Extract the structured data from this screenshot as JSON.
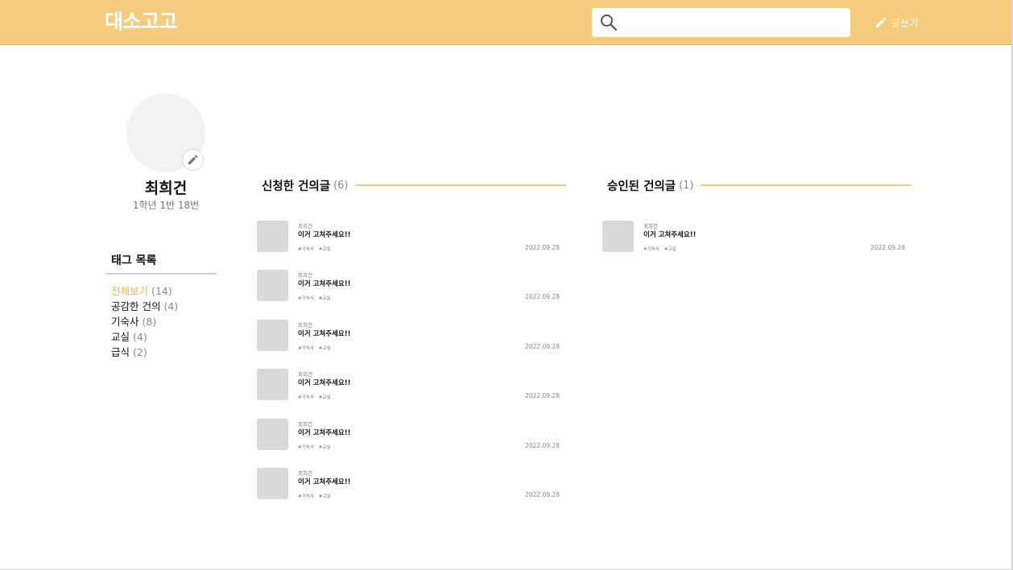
{
  "header": {
    "logo": "대소고고",
    "search_placeholder": "",
    "write_label": "글쓰기"
  },
  "profile": {
    "name": "최희건",
    "class_info": "1학년 1반 18번"
  },
  "tags": {
    "title": "태그 목록",
    "items": [
      {
        "label": "전체보기",
        "count": "(14)",
        "active": true
      },
      {
        "label": "공감한 건의",
        "count": "(4)",
        "active": false
      },
      {
        "label": "기숙사",
        "count": "(8)",
        "active": false
      },
      {
        "label": "교실",
        "count": "(4)",
        "active": false
      },
      {
        "label": "급식",
        "count": "(2)",
        "active": false
      }
    ]
  },
  "applied": {
    "title": "신청한 건의글",
    "count": "(6)",
    "posts": [
      {
        "author": "최희건",
        "title": "이거 고쳐주세요!!",
        "tags": [
          "#기숙사",
          "#교실"
        ],
        "date": "2022.09.28"
      },
      {
        "author": "최희건",
        "title": "이거 고쳐주세요!!",
        "tags": [
          "#기숙사",
          "#교실"
        ],
        "date": "2022.09.28"
      },
      {
        "author": "최희건",
        "title": "이거 고쳐주세요!!",
        "tags": [
          "#기숙사",
          "#교실"
        ],
        "date": "2022.09.28"
      },
      {
        "author": "최희건",
        "title": "이거 고쳐주세요!!",
        "tags": [
          "#기숙사",
          "#교실"
        ],
        "date": "2022.09.28"
      },
      {
        "author": "최희건",
        "title": "이거 고쳐주세요!!",
        "tags": [
          "#기숙사",
          "#교실"
        ],
        "date": "2022.09.28"
      },
      {
        "author": "최희건",
        "title": "이거 고쳐주세요!!",
        "tags": [
          "#기숙사",
          "#교실"
        ],
        "date": "2022.09.28"
      }
    ]
  },
  "approved": {
    "title": "승인된 건의글",
    "count": "(1)",
    "posts": [
      {
        "author": "최희건",
        "title": "이거 고쳐주세요!!",
        "tags": [
          "#기숙사",
          "#교실"
        ],
        "date": "2022.09.28"
      }
    ]
  },
  "colors": {
    "brand": "#f5cb7d",
    "active_tag": "#f2b43d"
  },
  "icons": {
    "search": "search-icon",
    "write": "pencil-icon",
    "avatar_edit": "pencil-icon"
  }
}
